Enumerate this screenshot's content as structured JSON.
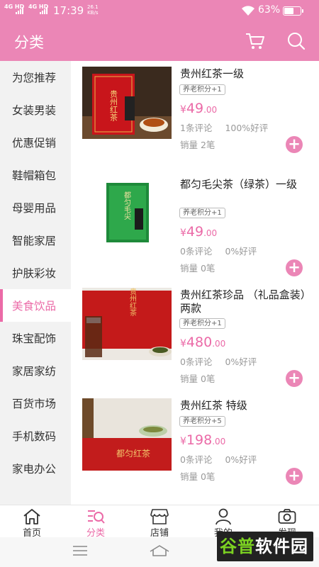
{
  "status_bar": {
    "network_1": "4G HD",
    "network_2": "4G HD",
    "time": "17:39",
    "speed_value": "26.1",
    "speed_unit": "KB/s",
    "battery": "63%",
    "battery_level": 0.63
  },
  "header": {
    "title": "分类",
    "cart_icon": "cart-icon",
    "search_icon": "search-icon"
  },
  "sidebar": {
    "active_index": 7,
    "items": [
      {
        "label": "为您推荐"
      },
      {
        "label": "女装男装"
      },
      {
        "label": "优惠促销"
      },
      {
        "label": "鞋帽箱包"
      },
      {
        "label": "母婴用品"
      },
      {
        "label": "智能家居"
      },
      {
        "label": "护肤彩妆"
      },
      {
        "label": "美食饮品"
      },
      {
        "label": "珠宝配饰"
      },
      {
        "label": "家居家纺"
      },
      {
        "label": "百货市场"
      },
      {
        "label": "手机数码"
      },
      {
        "label": "家电办公"
      }
    ]
  },
  "products": [
    {
      "name": "贵州红茶一级",
      "badge": "养老积分+1",
      "currency": "¥",
      "price_int": "49",
      "price_dec": ".00",
      "reviews": "1条评论",
      "rating": "100%好评",
      "sales": "销量 2笔",
      "package_text": "贵州红茶"
    },
    {
      "name": "都匀毛尖茶（绿茶）一级",
      "badge": "养老积分+1",
      "currency": "¥",
      "price_int": "49",
      "price_dec": ".00",
      "reviews": "0条评论",
      "rating": "0%好评",
      "sales": "销量 0笔",
      "package_text": "都匀毛尖"
    },
    {
      "name": "贵州红茶珍品 （礼品盒装）两款",
      "badge": "养老积分+1",
      "currency": "¥",
      "price_int": "480",
      "price_dec": ".00",
      "reviews": "0条评论",
      "rating": "0%好评",
      "sales": "销量 0笔",
      "package_text": "贵州红茶"
    },
    {
      "name": "贵州红茶 特级",
      "badge": "养老积分+5",
      "currency": "¥",
      "price_int": "198",
      "price_dec": ".00",
      "reviews": "0条评论",
      "rating": "0%好评",
      "sales": "销量 0笔",
      "package_text": "都匀红茶"
    }
  ],
  "bottom_nav": {
    "active_index": 1,
    "items": [
      {
        "label": "首页",
        "icon": "home-icon"
      },
      {
        "label": "分类",
        "icon": "category-icon"
      },
      {
        "label": "店铺",
        "icon": "store-icon"
      },
      {
        "label": "我的",
        "icon": "user-icon"
      },
      {
        "label": "发现",
        "icon": "camera-icon"
      }
    ]
  },
  "watermark": {
    "part1": "谷普",
    "part2": "软件园"
  },
  "colors": {
    "accent": "#eb86b6",
    "accent_text": "#eb6aa7",
    "sidebar_bg": "#f2f2f2"
  }
}
